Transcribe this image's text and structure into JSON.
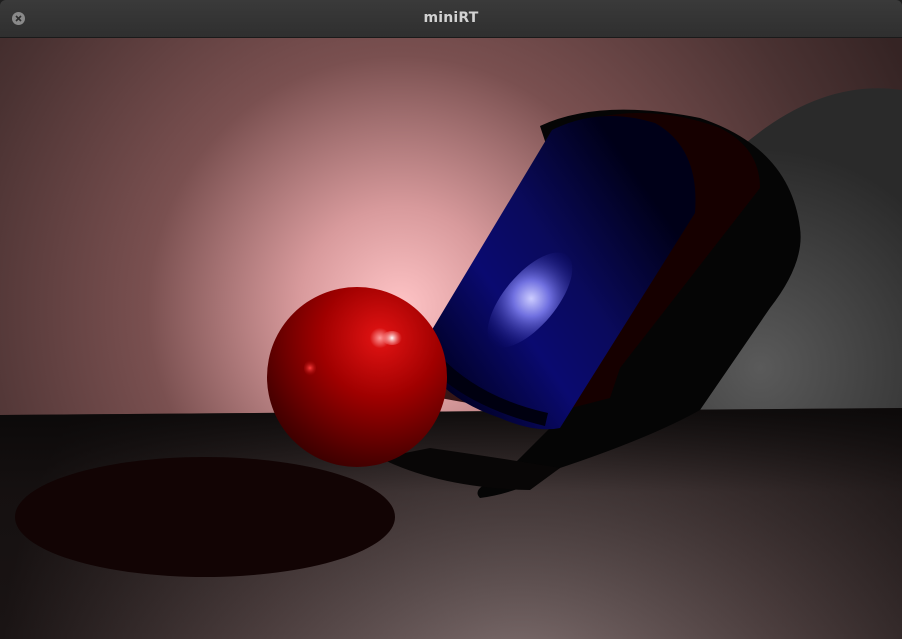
{
  "window": {
    "title": "miniRT",
    "close_icon": "close-icon"
  },
  "scene": {
    "objects": [
      "sphere",
      "cylinder",
      "plane"
    ],
    "colors": {
      "sphere": "#a00000",
      "cylinder": "#0a0a6e",
      "light_glow": "#ffc0c4",
      "floor": "#3a3030"
    }
  }
}
